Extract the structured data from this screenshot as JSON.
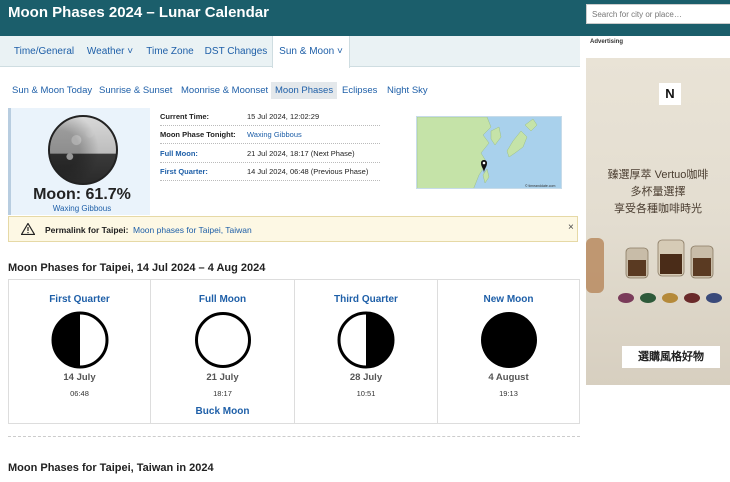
{
  "header": {
    "title": "Moon Phases 2024 – Lunar Calendar",
    "search_placeholder": "Search for city or place…"
  },
  "nav": {
    "items": [
      "Time/General",
      "Weather ˅",
      "Time Zone",
      "DST Changes",
      "Sun & Moon ˅"
    ],
    "active": "Sun & Moon ˅"
  },
  "subnav": {
    "items": [
      "Sun & Moon Today",
      "Sunrise & Sunset",
      "Moonrise & Moonset",
      "Moon Phases",
      "Eclipses",
      "Night Sky"
    ],
    "active": "Moon Phases"
  },
  "current": {
    "illumination": "Moon: 61.7%",
    "phase_name": "Waxing Gibbous",
    "rows": [
      {
        "label": "Current Time:",
        "value": "15 Jul 2024, 12:02:29",
        "label_link": false,
        "value_link": false
      },
      {
        "label": "Moon Phase Tonight:",
        "value": "Waxing Gibbous",
        "label_link": false,
        "value_link": true
      },
      {
        "label": "Full Moon:",
        "value": "21 Jul 2024, 18:17 (Next Phase)",
        "label_link": true,
        "value_link": false
      },
      {
        "label": "First Quarter:",
        "value": "14 Jul 2024, 06:48 (Previous Phase)",
        "label_link": true,
        "value_link": false
      }
    ],
    "map_credit": "© timeanddate.com"
  },
  "permalink": {
    "label": "Permalink for Taipei:",
    "value": "Moon phases for Taipei, Taiwan",
    "close": "×"
  },
  "section1": {
    "heading": "Moon Phases for Taipei, 14 Jul 2024 – 4 Aug 2024"
  },
  "phases": [
    {
      "name": "First Quarter",
      "date": "14 July",
      "time": "06:48",
      "extra": "",
      "icon": "first-quarter"
    },
    {
      "name": "Full Moon",
      "date": "21 July",
      "time": "18:17",
      "extra": "Buck Moon",
      "icon": "full"
    },
    {
      "name": "Third Quarter",
      "date": "28 July",
      "time": "10:51",
      "extra": "",
      "icon": "third-quarter"
    },
    {
      "name": "New Moon",
      "date": "4 August",
      "time": "19:13",
      "extra": "",
      "icon": "new"
    }
  ],
  "section2": {
    "heading": "Moon Phases for Taipei, Taiwan in 2024"
  },
  "sidebar": {
    "ad_label": "Advertising",
    "ad_logo": "N",
    "ad_lines": [
      "臻選厚萃 Vertuo咖啡",
      "多杯量選擇",
      "享受各種咖啡時光"
    ],
    "ad_button": "選購風格好物"
  },
  "colors": {
    "header_bg": "#1b5e6b",
    "link": "#1e5fa8",
    "moonbox_bg": "#eaf3fb",
    "permalink_bg": "#fdf8e4"
  }
}
